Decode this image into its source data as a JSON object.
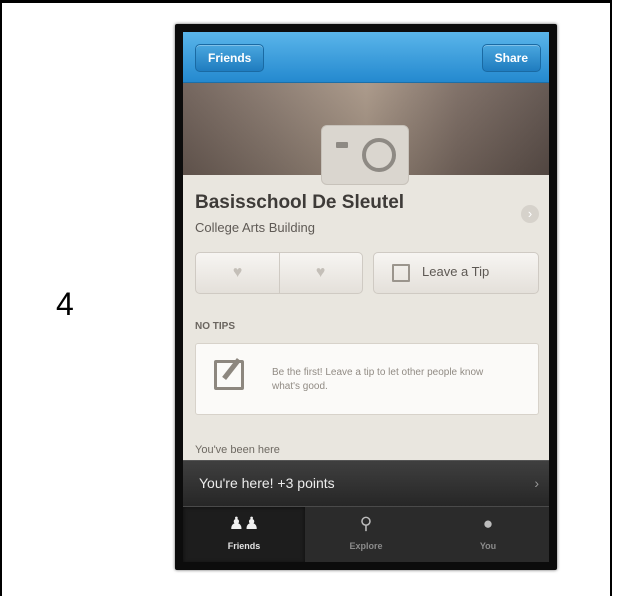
{
  "step_number": "4",
  "navbar": {
    "left_button": "Friends",
    "right_button": "Share"
  },
  "venue": {
    "name": "Basisschool De Sleutel",
    "subtitle": "College Arts Building"
  },
  "actions": {
    "tip_button": "Leave a Tip"
  },
  "tips": {
    "header": "NO TIPS",
    "empty_message": "Be the first! Leave a tip to let other people know what's good."
  },
  "history": {
    "been_here": "You've been here"
  },
  "checkin": {
    "points_message": "You're here! +3 points",
    "chevron": "›"
  },
  "tabbar": {
    "tabs": [
      {
        "label": "Friends",
        "icon": "friends-icon",
        "active": true
      },
      {
        "label": "Explore",
        "icon": "search-icon",
        "active": false
      },
      {
        "label": "You",
        "icon": "profile-icon",
        "active": false
      }
    ]
  },
  "colors": {
    "navbar_top": "#5ab5ea",
    "navbar_bottom": "#2489cf",
    "background": "#e9e6df",
    "points_bar": "#262626",
    "tabbar": "#2b2b2b"
  }
}
